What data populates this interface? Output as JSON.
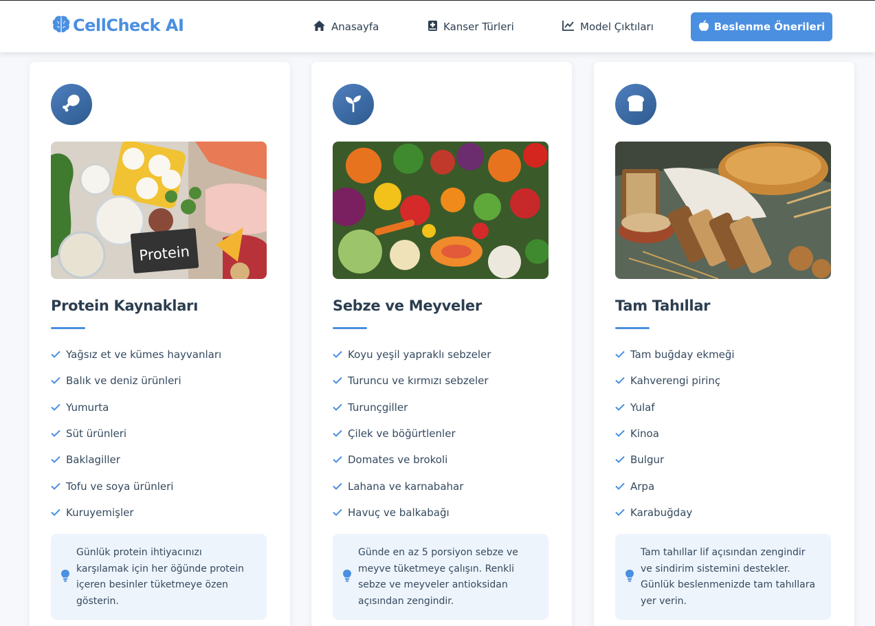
{
  "brand": {
    "name": "CellCheck AI"
  },
  "nav": {
    "home": "Anasayfa",
    "cancer_types": "Kanser Türleri",
    "model_outputs": "Model Çıktıları",
    "nutrition": "Beslenme Önerileri"
  },
  "colors": {
    "accent": "#4a8fe0",
    "icon_bg": "#3a6aa8",
    "tip_bg": "#eef4fc"
  },
  "cards": [
    {
      "icon": "drumstick-icon",
      "title": "Protein Kaynakları",
      "items": [
        "Yağsız et ve kümes hayvanları",
        "Balık ve deniz ürünleri",
        "Yumurta",
        "Süt ürünleri",
        "Baklagiller",
        "Tofu ve soya ürünleri",
        "Kuruyemişler"
      ],
      "tip": "Günlük protein ihtiyacınızı karşılamak için her öğünde protein içeren besinler tüketmeye özen gösterin.",
      "photo_label": "Protein"
    },
    {
      "icon": "seedling-icon",
      "title": "Sebze ve Meyveler",
      "items": [
        "Koyu yeşil yapraklı sebzeler",
        "Turuncu ve kırmızı sebzeler",
        "Turunçgiller",
        "Çilek ve böğürtlenler",
        "Domates ve brokoli",
        "Lahana ve karnabahar",
        "Havuç ve balkabağı"
      ],
      "tip": "Günde en az 5 porsiyon sebze ve meyve tüketmeye çalışın. Renkli sebze ve meyveler antioksidan açısından zengindir."
    },
    {
      "icon": "bread-icon",
      "title": "Tam Tahıllar",
      "items": [
        "Tam buğday ekmeği",
        "Kahverengi pirinç",
        "Yulaf",
        "Kinoa",
        "Bulgur",
        "Arpa",
        "Karabuğday"
      ],
      "tip": "Tam tahıllar lif açısından zengindir ve sindirim sistemini destekler. Günlük beslenmenizde tam tahıllara yer verin."
    }
  ]
}
